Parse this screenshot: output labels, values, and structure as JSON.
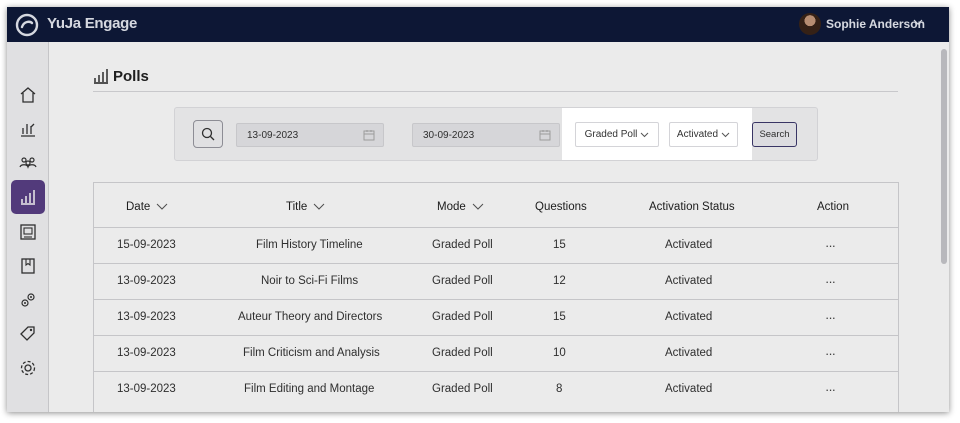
{
  "app": {
    "brand": "YuJa Engage",
    "user_name": "Sophie Anderson"
  },
  "sidebar": {
    "items": [
      {
        "icon": "home-icon"
      },
      {
        "icon": "reports-icon"
      },
      {
        "icon": "users-icon"
      },
      {
        "icon": "polls-icon",
        "active": true
      },
      {
        "icon": "gallery-icon"
      },
      {
        "icon": "book-icon"
      },
      {
        "icon": "integrations-icon"
      },
      {
        "icon": "tag-icon"
      },
      {
        "icon": "settings-icon"
      }
    ],
    "active_color": "#5a3f86"
  },
  "page": {
    "title": "Polls"
  },
  "filters": {
    "start_date": "13-09-2023",
    "end_date": "30-09-2023",
    "mode_select": "Graded Poll",
    "status_select": "Activated",
    "search_label": "Search"
  },
  "table": {
    "headers": {
      "date": "Date",
      "title": "Title",
      "mode": "Mode",
      "questions": "Questions",
      "status": "Activation Status",
      "action": "Action"
    },
    "rows": [
      {
        "date": "15-09-2023",
        "title": "Film History Timeline",
        "mode": "Graded Poll",
        "questions": "15",
        "status": "Activated",
        "action": "···"
      },
      {
        "date": "13-09-2023",
        "title": "Noir to Sci-Fi Films",
        "mode": "Graded Poll",
        "questions": "12",
        "status": "Activated",
        "action": "···"
      },
      {
        "date": "13-09-2023",
        "title": "Auteur Theory and Directors",
        "mode": "Graded Poll",
        "questions": "15",
        "status": "Activated",
        "action": "···"
      },
      {
        "date": "13-09-2023",
        "title": "Film Criticism and Analysis",
        "mode": "Graded Poll",
        "questions": "10",
        "status": "Activated",
        "action": "···"
      },
      {
        "date": "13-09-2023",
        "title": "Film Editing and Montage",
        "mode": "Graded Poll",
        "questions": "8",
        "status": "Activated",
        "action": "···"
      }
    ]
  },
  "colors": {
    "topbar": "#0f1a3a",
    "accent": "#5a3f86"
  }
}
